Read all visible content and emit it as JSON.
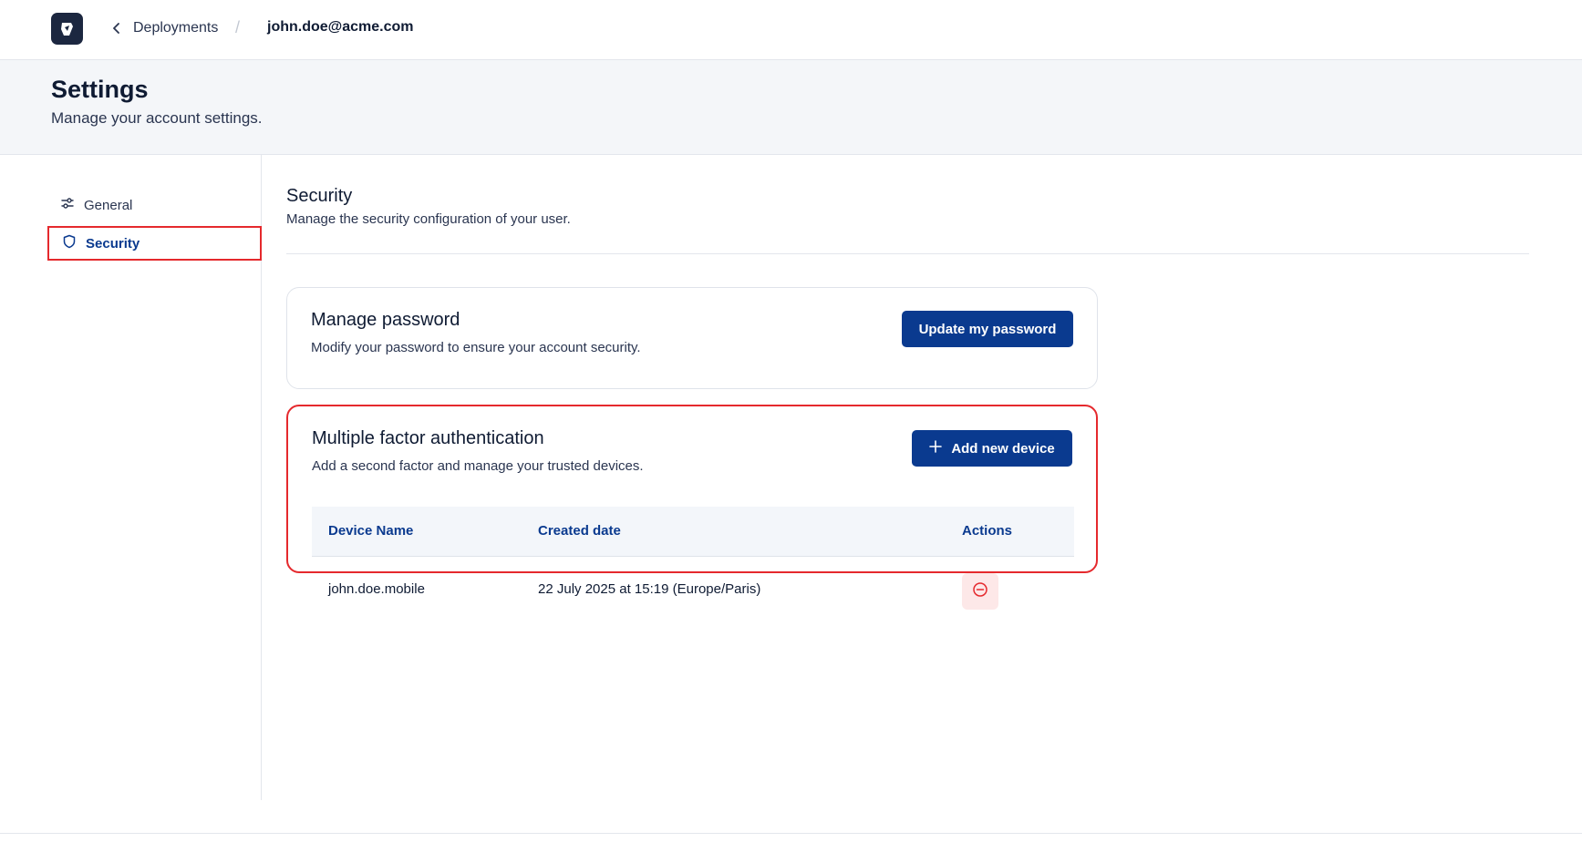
{
  "topbar": {
    "logo_icon": "cloud-shield-logo-icon",
    "back_icon": "chevron-left-icon",
    "back_label": "Deployments",
    "separator": "/",
    "current": "john.doe@acme.com"
  },
  "header": {
    "title": "Settings",
    "subtitle": "Manage your account settings."
  },
  "sidebar": {
    "items": [
      {
        "label": "General",
        "icon": "sliders-icon",
        "active": false
      },
      {
        "label": "Security",
        "icon": "shield-icon",
        "active": true
      }
    ]
  },
  "section": {
    "title": "Security",
    "subtitle": "Manage the security configuration of your user."
  },
  "password_card": {
    "title": "Manage password",
    "subtitle": "Modify your password to ensure your account security.",
    "button_label": "Update my password"
  },
  "mfa_card": {
    "title": "Multiple factor authentication",
    "subtitle": "Add a second factor and manage your trusted devices.",
    "button_icon": "plus-icon",
    "button_label": "Add new device",
    "table": {
      "headers": [
        "Device Name",
        "Created date",
        "Actions"
      ],
      "rows": [
        {
          "device": "john.doe.mobile",
          "created": "22 July 2025 at 15:19 (Europe/Paris)",
          "action_icon": "remove-circle-icon"
        }
      ]
    }
  },
  "colors": {
    "primary": "#0a3a8f",
    "highlight": "#e5292d",
    "danger_bg": "#fde8e8",
    "header_bg": "#f4f6f9"
  }
}
